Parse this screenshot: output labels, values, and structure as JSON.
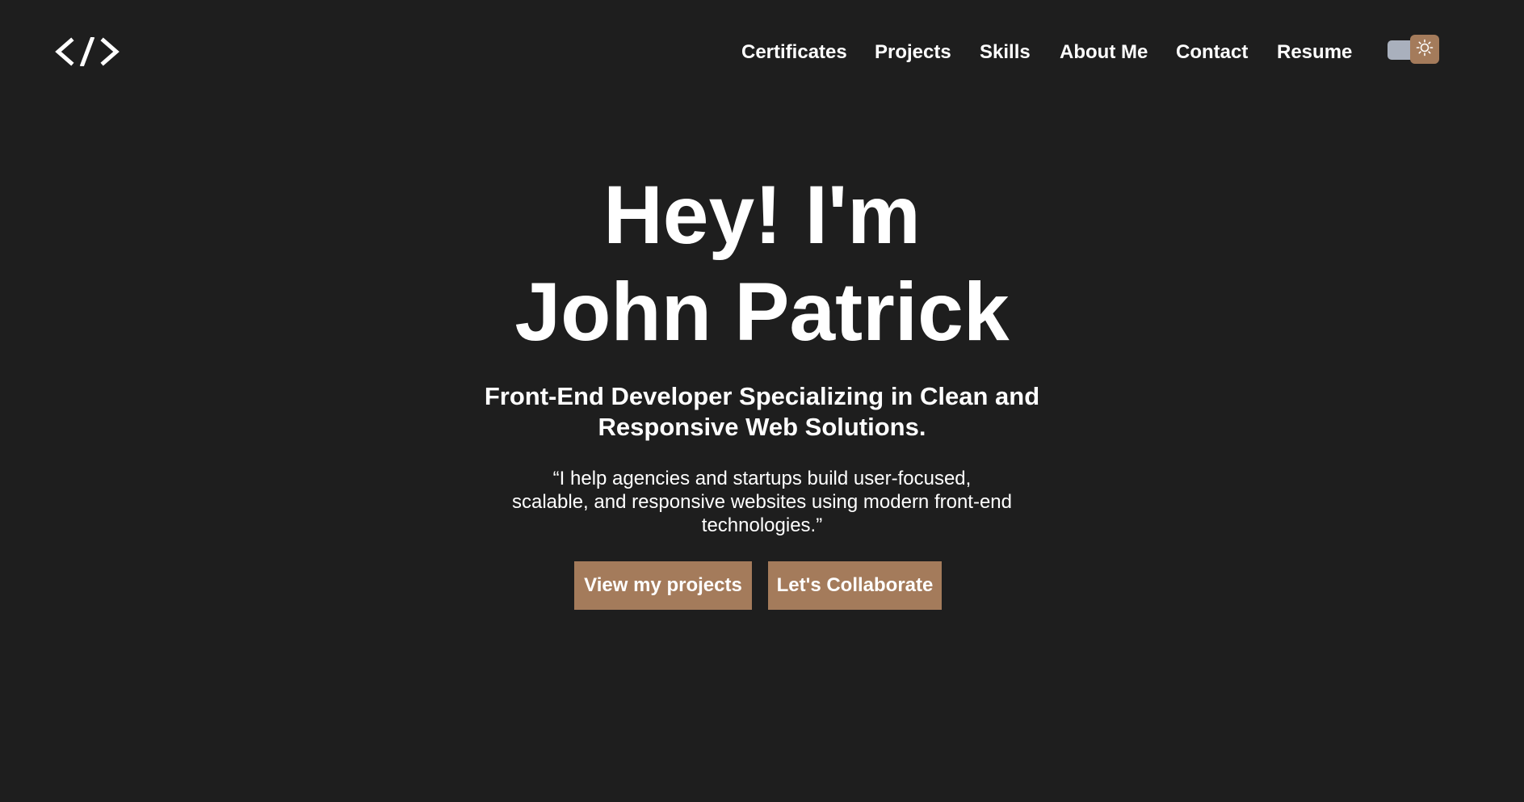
{
  "header": {
    "logo_icon": "code-brackets-icon",
    "nav": [
      {
        "label": "Certificates"
      },
      {
        "label": "Projects"
      },
      {
        "label": "Skills"
      },
      {
        "label": "About Me"
      },
      {
        "label": "Contact"
      },
      {
        "label": "Resume"
      }
    ],
    "theme_toggle": {
      "icon": "sun-icon",
      "state": "dark"
    }
  },
  "hero": {
    "title_line1": "Hey! I'm",
    "title_line2": "John Patrick",
    "subtitle_line1": "Front-End Developer Specializing in Clean and",
    "subtitle_line2": "Responsive Web Solutions.",
    "quote_line1": "“I help agencies and startups build user-focused,",
    "quote_line2": "scalable, and responsive websites using modern front-end",
    "quote_line3": "technologies.”",
    "primary_button": "View my projects",
    "secondary_button": "Let's Collaborate"
  },
  "colors": {
    "background": "#1e1e1e",
    "accent": "#a47b5b",
    "text": "#ffffff",
    "toggle_track": "#a9b0bd"
  }
}
